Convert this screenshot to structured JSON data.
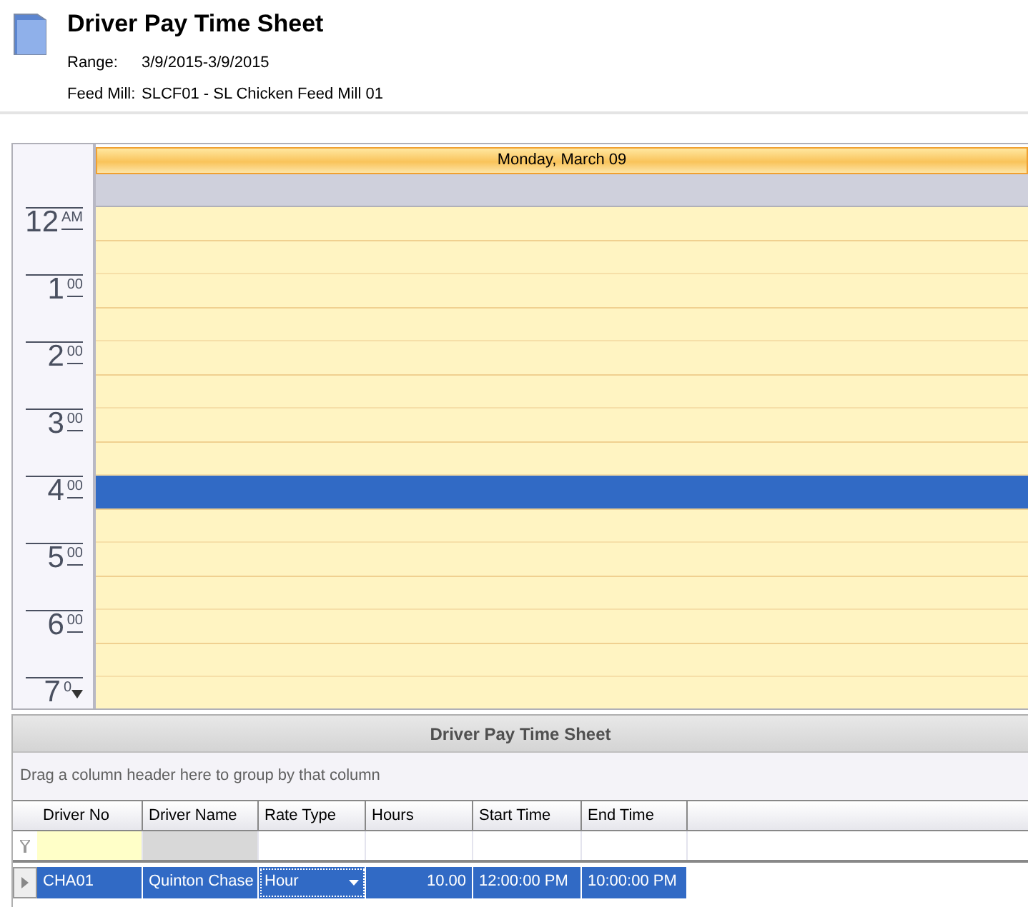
{
  "header": {
    "title": "Driver Pay Time Sheet",
    "fields": [
      {
        "label": "Range:",
        "value": "3/9/2015-3/9/2015"
      },
      {
        "label": "Feed Mill:",
        "value": "SLCF01 - SL Chicken Feed Mill 01"
      }
    ]
  },
  "calendar": {
    "day_header": "Monday, March 09",
    "hours": [
      {
        "hour": "12",
        "suffix": "AM"
      },
      {
        "hour": "1",
        "suffix": "00"
      },
      {
        "hour": "2",
        "suffix": "00"
      },
      {
        "hour": "3",
        "suffix": "00"
      },
      {
        "hour": "4",
        "suffix": "00"
      },
      {
        "hour": "5",
        "suffix": "00"
      },
      {
        "hour": "6",
        "suffix": "00"
      },
      {
        "hour": "7",
        "suffix": "0"
      }
    ],
    "slots": [
      {
        "selected": false
      },
      {
        "selected": false
      },
      {
        "selected": false
      },
      {
        "selected": false
      },
      {
        "selected": false
      },
      {
        "selected": false
      },
      {
        "selected": false
      },
      {
        "selected": false
      },
      {
        "selected": true
      },
      {
        "selected": false
      },
      {
        "selected": false
      },
      {
        "selected": false
      },
      {
        "selected": false
      },
      {
        "selected": false
      },
      {
        "selected": false
      }
    ]
  },
  "grid": {
    "title": "Driver Pay Time Sheet",
    "group_hint": "Drag a column header here to group by that column",
    "columns": [
      "Driver No",
      "Driver Name",
      "Rate Type",
      "Hours",
      "Start Time",
      "End Time"
    ],
    "rows": [
      {
        "selected": true,
        "cells": [
          "CHA01",
          "Quinton Chase",
          "Hour",
          "10.00",
          "12:00:00 PM",
          "10:00:00 PM"
        ]
      }
    ]
  }
}
